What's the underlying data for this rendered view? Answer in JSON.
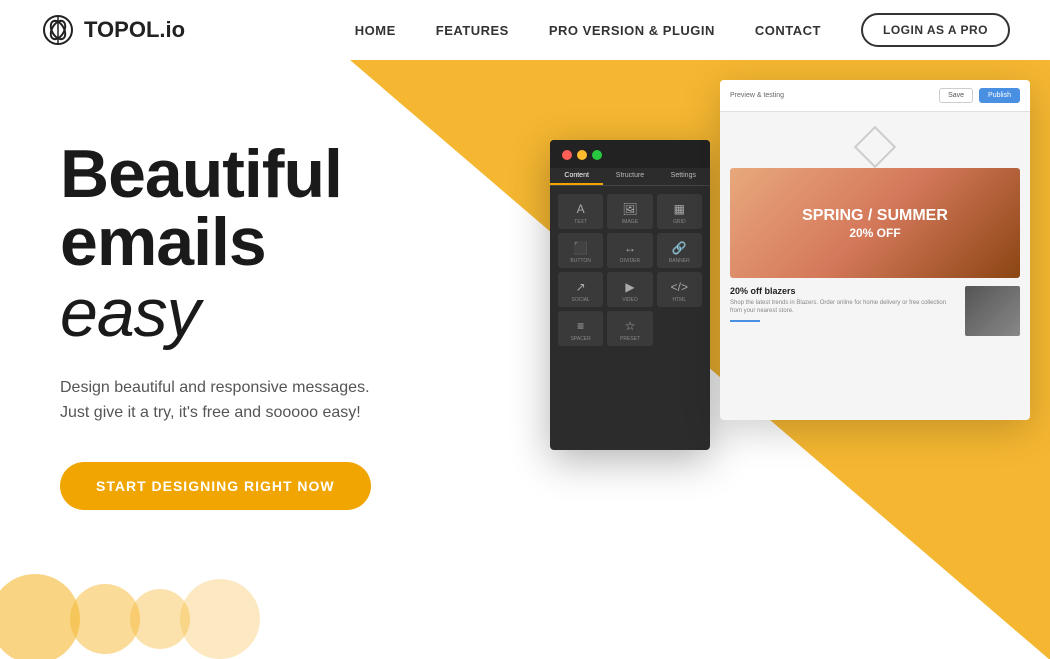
{
  "header": {
    "logo_text": "TOPOL.io",
    "nav_items": [
      {
        "label": "HOME",
        "id": "home"
      },
      {
        "label": "FEATURES",
        "id": "features"
      },
      {
        "label": "PRO VERSION & PLUGIN",
        "id": "pro"
      },
      {
        "label": "CONTACT",
        "id": "contact"
      }
    ],
    "login_button": "LOGIN AS A PRO"
  },
  "hero": {
    "title_bold": "Beautiful emails",
    "title_light": "easy",
    "description_line1": "Design beautiful and responsive messages.",
    "description_line2": "Just give it a try, it's free and sooooo easy!",
    "cta_label": "START DESIGNING RIGHT NOW"
  },
  "editor": {
    "tabs": [
      "Content",
      "Structure",
      "Settings"
    ],
    "blocks": [
      {
        "icon": "A",
        "label": "TEXT"
      },
      {
        "icon": "🖼",
        "label": "IMAGE"
      },
      {
        "icon": "▦",
        "label": "GRID"
      },
      {
        "icon": "⬛",
        "label": "BUTTON"
      },
      {
        "icon": "↔",
        "label": "DIVIDER"
      },
      {
        "icon": "🔗",
        "label": "BANNER"
      },
      {
        "icon": "↗",
        "label": "SOCIAL"
      },
      {
        "icon": "▶",
        "label": "VIDEO"
      },
      {
        "icon": "</>",
        "label": "HTML"
      },
      {
        "icon": "≡",
        "label": "SPACER"
      },
      {
        "icon": "☆",
        "label": "PRESET"
      }
    ]
  },
  "preview": {
    "topbar_label": "Preview & testing",
    "save_btn": "Save",
    "publish_btn": "Publish",
    "hero_line1": "SPRING / SUMMER",
    "hero_line2": "20% OFF",
    "card_title": "20% off blazers",
    "card_desc": "Shop the latest trends in Blazers. Order online for home delivery or free collection from your nearest store."
  }
}
